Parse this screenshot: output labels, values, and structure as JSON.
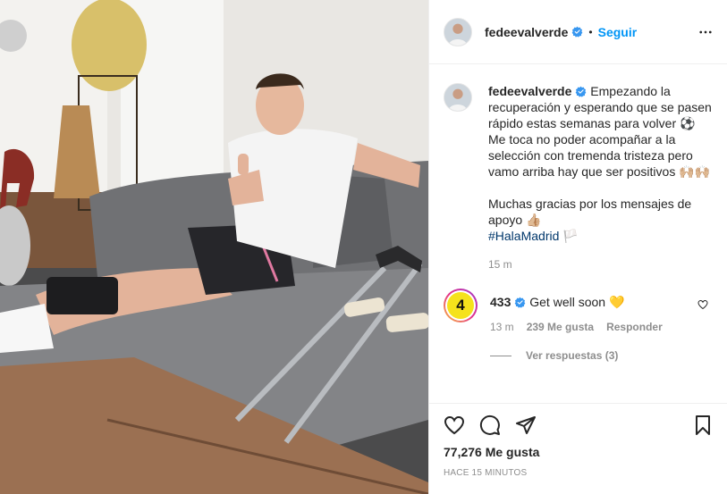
{
  "author": {
    "username": "fedeevalverde",
    "follow_label": "Seguir",
    "separator": "•"
  },
  "caption": {
    "lines": [
      "Empezando la recuperación y esperando que se pasen rápido estas semanas para volver ⚽",
      "Me toca no poder acompañar a la selección con tremenda tristeza pero vamo arriba hay que ser positivos 🙌🏼🙌🏼",
      "",
      "Muchas gracias por los mensajes de apoyo 👍🏼"
    ],
    "hashtag": "#HalaMadrid",
    "hashtag_suffix": " 🏳️",
    "time": "15 m"
  },
  "comment": {
    "avatar_text": "4",
    "username": "433",
    "text": "Get well soon 💛",
    "time": "13 m",
    "likes": "239 Me gusta",
    "reply_label": "Responder",
    "view_replies": "Ver respuestas (3)"
  },
  "post": {
    "likes": "77,276 Me gusta",
    "time_ago": "HACE 15 MINUTOS"
  },
  "icons": {
    "verified": "verified-badge",
    "more": "more-horizontal",
    "like": "heart-outline",
    "comment": "speech-bubble",
    "share": "paper-plane",
    "save": "bookmark"
  },
  "colors": {
    "follow_blue": "#0095f6",
    "verified_blue": "#3897f0",
    "hashtag": "#00376b",
    "muted": "#8e8e8e"
  }
}
